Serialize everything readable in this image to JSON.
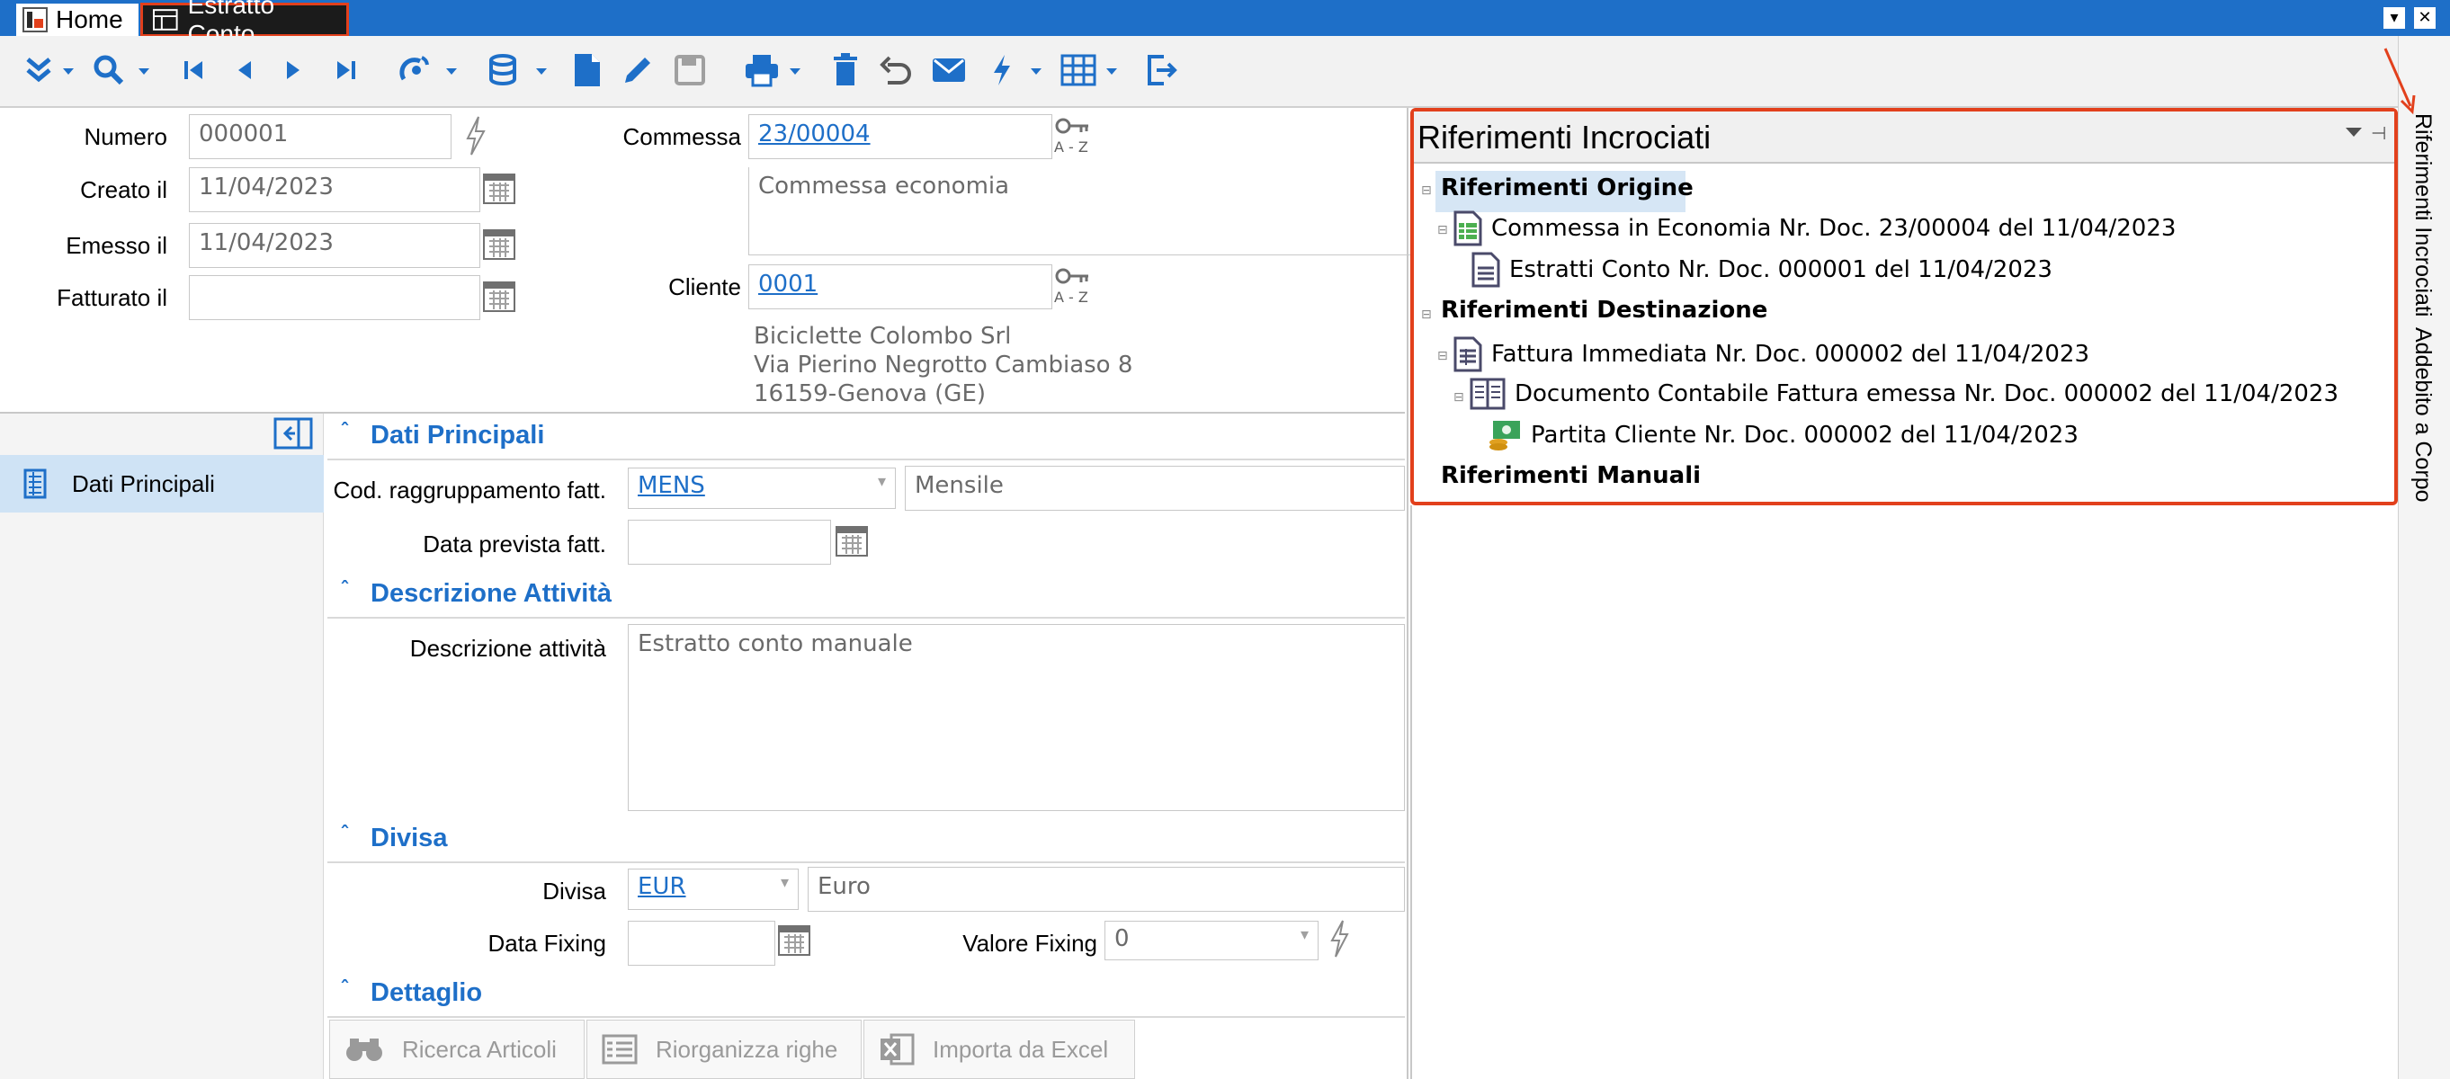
{
  "window": {
    "tabs": [
      {
        "label": "Home"
      },
      {
        "label": "Estratto Conto"
      }
    ]
  },
  "toolbar": {
    "icons": [
      "collapse-icon",
      "search-icon",
      "first-record-icon",
      "previous-record-icon",
      "next-record-icon",
      "last-record-icon",
      "satellite-icon",
      "database-icon",
      "new-document-icon",
      "edit-icon",
      "save-icon",
      "print-icon",
      "delete-icon",
      "undo-icon",
      "email-icon",
      "lightning-icon",
      "grid-icon",
      "exit-icon"
    ]
  },
  "header": {
    "numero_label": "Numero",
    "numero_value": "000001",
    "creato_label": "Creato il",
    "creato_value": "11/04/2023",
    "emesso_label": "Emesso il",
    "emesso_value": "11/04/2023",
    "fatturato_label": "Fatturato il",
    "fatturato_value": "",
    "commessa_label": "Commessa",
    "commessa_value": "23/00004",
    "commessa_desc": "Commessa economia",
    "cliente_label": "Cliente",
    "cliente_value": "0001",
    "cliente_name": "Biciclette Colombo Srl",
    "cliente_address": "Via Pierino Negrotto Cambiaso 8",
    "cliente_city": "16159-Genova (GE)",
    "az_label": "A - Z"
  },
  "nav": {
    "items": [
      {
        "label": "Dati Principali"
      }
    ]
  },
  "sections": {
    "dati_principali": {
      "title": "Dati Principali",
      "cod_label": "Cod. raggruppamento fatt.",
      "cod_value": "MENS",
      "cod_desc": "Mensile",
      "data_prevista_label": "Data prevista fatt.",
      "data_prevista_value": ""
    },
    "descrizione": {
      "title": "Descrizione Attività",
      "label": "Descrizione attività",
      "value": "Estratto conto manuale"
    },
    "divisa": {
      "title": "Divisa",
      "divisa_label": "Divisa",
      "divisa_value": "EUR",
      "divisa_desc": "Euro",
      "data_fixing_label": "Data Fixing",
      "data_fixing_value": "",
      "valore_fixing_label": "Valore Fixing",
      "valore_fixing_value": "0"
    },
    "dettaglio": {
      "title": "Dettaglio",
      "buttons": [
        {
          "label": "Ricerca Articoli"
        },
        {
          "label": "Riorganizza righe"
        },
        {
          "label": "Importa da Excel"
        }
      ]
    }
  },
  "references": {
    "title": "Riferimenti Incrociati",
    "origine_label": "Riferimenti Origine",
    "origine_items": [
      "Commessa in Economia Nr. Doc. 23/00004 del 11/04/2023",
      "Estratti Conto Nr. Doc. 000001 del 11/04/2023"
    ],
    "destinazione_label": "Riferimenti Destinazione",
    "destinazione_items": [
      "Fattura Immediata Nr. Doc. 000002 del 11/04/2023",
      "Documento Contabile Fattura emessa Nr. Doc. 000002 del 11/04/2023",
      "Partita Cliente Nr. Doc. 000002 del 11/04/2023"
    ],
    "manuali_label": "Riferimenti Manuali"
  },
  "side_tabs": {
    "riferimenti": "Riferimenti Incrociati",
    "addebito": "Addebito a Corpo"
  },
  "colors": {
    "accent": "#1e6fc8",
    "highlight": "#e2401c",
    "nav_selected": "#cfe3f5"
  }
}
